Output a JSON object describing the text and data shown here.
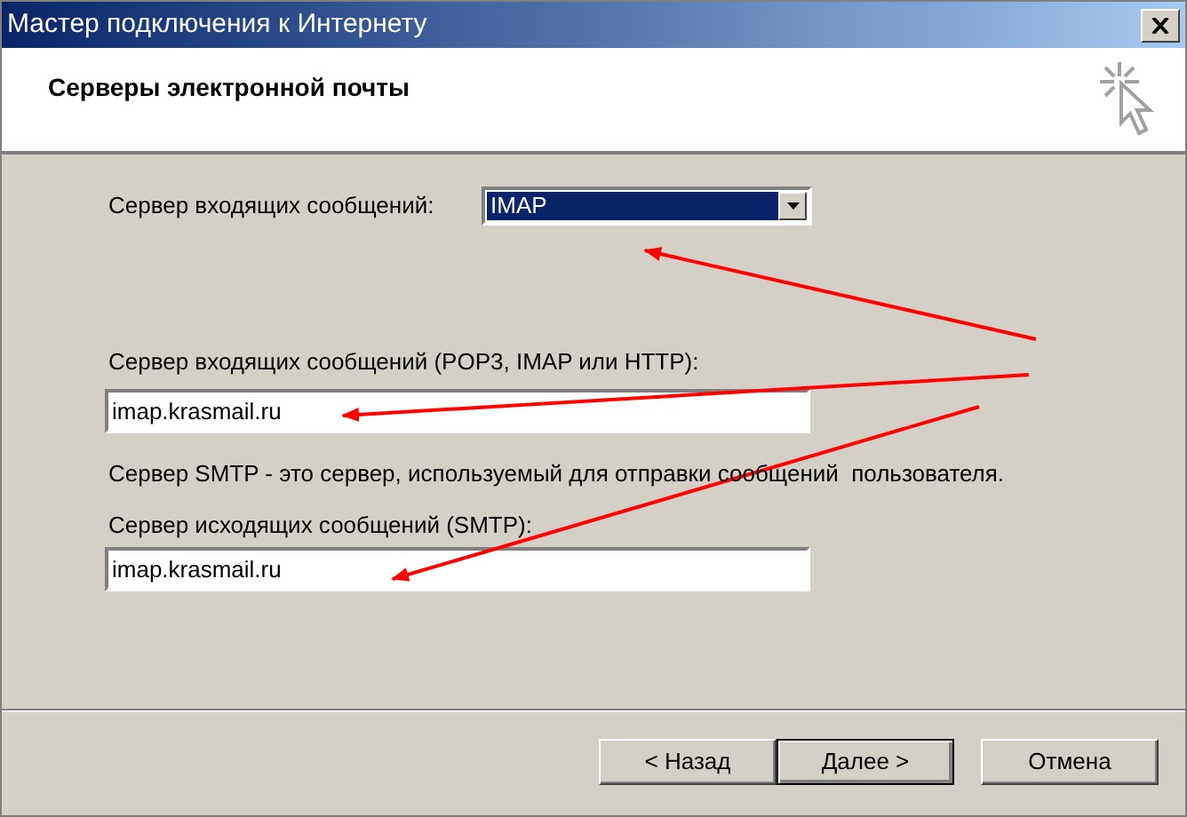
{
  "window": {
    "title": "Мастер подключения к Интернету"
  },
  "header": {
    "title": "Серверы электронной почты"
  },
  "incoming_type": {
    "label": "Сервер входящих сообщений:",
    "value": "IMAP"
  },
  "incoming_server": {
    "label": "Сервер входящих сообщений (POP3, IMAP или HTTP):",
    "value": "imap.krasmail.ru"
  },
  "note": "Сервер SMTP - это сервер, используемый для отправки сообщений  пользователя.",
  "outgoing_server": {
    "label": "Сервер исходящих сообщений (SMTP):",
    "value": "imap.krasmail.ru"
  },
  "buttons": [
    {
      "label": "< Назад",
      "default": false
    },
    {
      "label": "Далее >",
      "default": true
    },
    {
      "label": "Отмена",
      "default": false
    }
  ]
}
